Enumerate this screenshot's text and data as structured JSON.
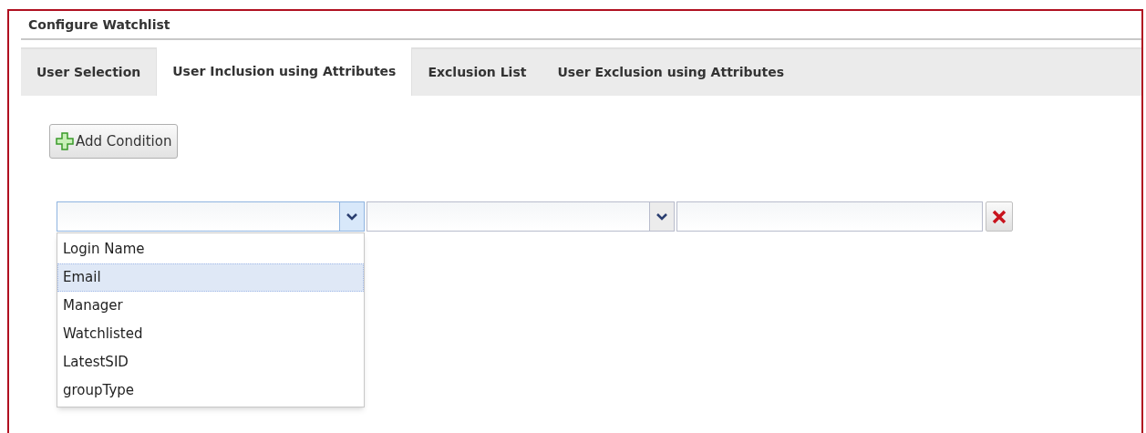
{
  "panel": {
    "title": "Configure Watchlist"
  },
  "tabs": [
    {
      "label": "User Selection",
      "selected": false
    },
    {
      "label": "User Inclusion using Attributes",
      "selected": true
    },
    {
      "label": "Exclusion List",
      "selected": false
    },
    {
      "label": "User Exclusion using Attributes",
      "selected": false
    }
  ],
  "add_button": {
    "label": "Add Condition"
  },
  "condition": {
    "attribute_dropdown": {
      "expanded": true,
      "options": [
        {
          "label": "Login Name",
          "selected": false
        },
        {
          "label": "Email",
          "selected": true
        },
        {
          "label": "Manager",
          "selected": false
        },
        {
          "label": "Watchlisted",
          "selected": false
        },
        {
          "label": "LatestSID",
          "selected": false
        },
        {
          "label": "groupType",
          "selected": false
        }
      ]
    },
    "operator_dropdown": {
      "expanded": false
    }
  }
}
